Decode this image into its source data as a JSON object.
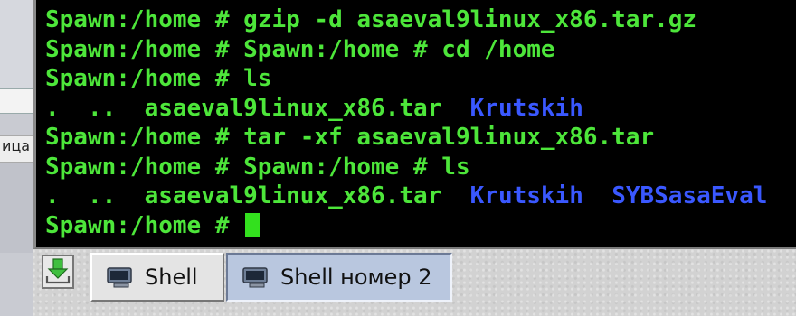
{
  "terminal": {
    "prompt": "Spawn:/home #",
    "lines": [
      {
        "prompt": "Spawn:/home #",
        "cmd": " gzip -d asaeval9linux_x86.tar.gz"
      },
      {
        "prompt": "Spawn:/home #",
        "cmd": " Spawn:/home # cd /home"
      },
      {
        "prompt": "Spawn:/home #",
        "cmd": " ls"
      },
      {
        "listing": [
          ".",
          "..",
          "asaeval9linux_x86.tar",
          "Krutskih"
        ]
      },
      {
        "prompt": "Spawn:/home #",
        "cmd": " tar -xf asaeval9linux_x86.tar"
      },
      {
        "prompt": "Spawn:/home #",
        "cmd": " Spawn:/home # ls"
      },
      {
        "listing": [
          ".",
          "..",
          "asaeval9linux_x86.tar",
          "Krutskih",
          "SYBSasaEval"
        ]
      },
      {
        "prompt": "Spawn:/home #",
        "cmd": " "
      }
    ],
    "colors": {
      "text": "#4de63a",
      "directory": "#3a58ff",
      "background": "#000000",
      "cursor": "#33e01e"
    }
  },
  "behind_window": {
    "label": "ица"
  },
  "taskbar": {
    "launcher_icon": "download-tray-icon",
    "tasks": [
      {
        "label": "Shell",
        "icon": "terminal-monitor-icon",
        "active": false
      },
      {
        "label": "Shell номер 2",
        "icon": "terminal-monitor-icon",
        "active": true
      }
    ]
  }
}
